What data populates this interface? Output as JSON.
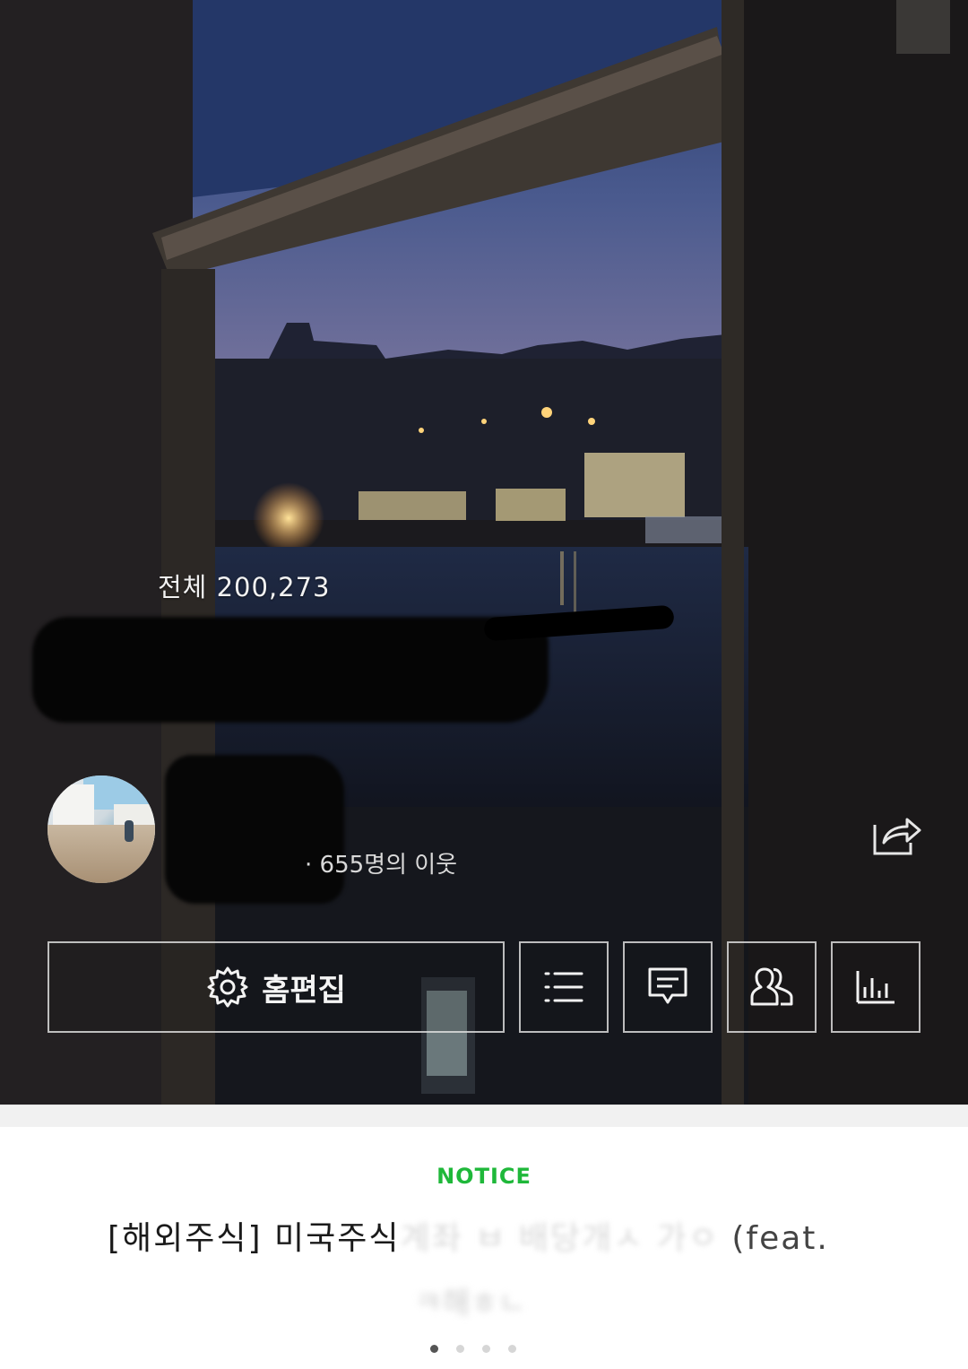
{
  "hero": {
    "total_label": "전체 200,273",
    "neighbors_label": "· 655명의 이웃"
  },
  "buttons": {
    "edit_label": "홈편집"
  },
  "notice": {
    "label": "NOTICE",
    "title_visible": "[해외주식] 미국주식",
    "title_blurred": "계좌 ㅂ 배당개ㅅ 가ㅇ ",
    "title_tail": "(feat.",
    "line2_blurred": "ㅋ해ㅎㄴ"
  },
  "icons": {
    "settings": "gear-icon",
    "list": "list-icon",
    "comment": "comment-icon",
    "people": "people-icon",
    "stats": "stats-icon",
    "share": "share-icon"
  },
  "colors": {
    "accent": "#1fb83a"
  }
}
